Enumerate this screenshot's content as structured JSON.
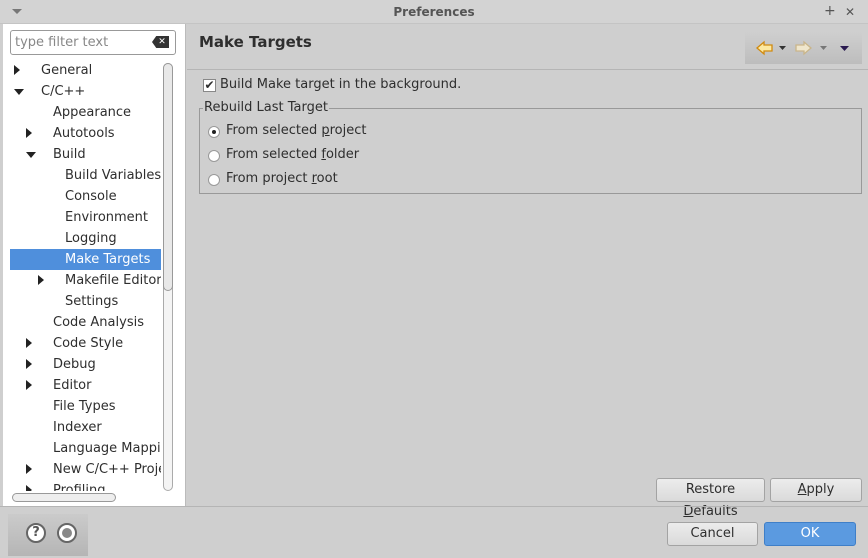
{
  "window": {
    "title": "Preferences",
    "maximize": "+",
    "close": "✕"
  },
  "filter": {
    "placeholder": "type filter text"
  },
  "tree": [
    {
      "label": "General",
      "level": 0,
      "arrow": "right"
    },
    {
      "label": "C/C++",
      "level": 0,
      "arrow": "down"
    },
    {
      "label": "Appearance",
      "level": 1,
      "arrow": ""
    },
    {
      "label": "Autotools",
      "level": 1,
      "arrow": "right"
    },
    {
      "label": "Build",
      "level": 1,
      "arrow": "down"
    },
    {
      "label": "Build Variables",
      "level": 2,
      "arrow": ""
    },
    {
      "label": "Console",
      "level": 2,
      "arrow": ""
    },
    {
      "label": "Environment",
      "level": 2,
      "arrow": ""
    },
    {
      "label": "Logging",
      "level": 2,
      "arrow": ""
    },
    {
      "label": "Make Targets",
      "level": 2,
      "arrow": "",
      "selected": true
    },
    {
      "label": "Makefile Editor",
      "level": 2,
      "arrow": "right"
    },
    {
      "label": "Settings",
      "level": 2,
      "arrow": ""
    },
    {
      "label": "Code Analysis",
      "level": 1,
      "arrow": ""
    },
    {
      "label": "Code Style",
      "level": 1,
      "arrow": "right"
    },
    {
      "label": "Debug",
      "level": 1,
      "arrow": "right"
    },
    {
      "label": "Editor",
      "level": 1,
      "arrow": "right"
    },
    {
      "label": "File Types",
      "level": 1,
      "arrow": ""
    },
    {
      "label": "Indexer",
      "level": 1,
      "arrow": ""
    },
    {
      "label": "Language Mappings",
      "level": 1,
      "arrow": ""
    },
    {
      "label": "New C/C++ Project",
      "level": 1,
      "arrow": "right"
    },
    {
      "label": "Profiling",
      "level": 1,
      "arrow": "right"
    }
  ],
  "page": {
    "title": "Make Targets",
    "checkbox_label": "Build Make target in the background.",
    "checkbox_checked": true,
    "group_label": "Rebuild Last Target",
    "radios": [
      {
        "pre": "From selected ",
        "u": "p",
        "post": "roject",
        "checked": true
      },
      {
        "pre": "From selected ",
        "u": "f",
        "post": "older",
        "checked": false
      },
      {
        "pre": "From project ",
        "u": "r",
        "post": "oot",
        "checked": false
      }
    ],
    "restore": {
      "pre": "Restore ",
      "u": "D",
      "post": "efaults"
    },
    "apply": {
      "pre": "",
      "u": "A",
      "post": "pply"
    }
  },
  "footer": {
    "help": "?",
    "cancel": "Cancel",
    "ok": "OK"
  },
  "colors": {
    "selection": "#4f8fdc",
    "ok": "#5b9ae0",
    "back_arrow": "#f0b030"
  }
}
